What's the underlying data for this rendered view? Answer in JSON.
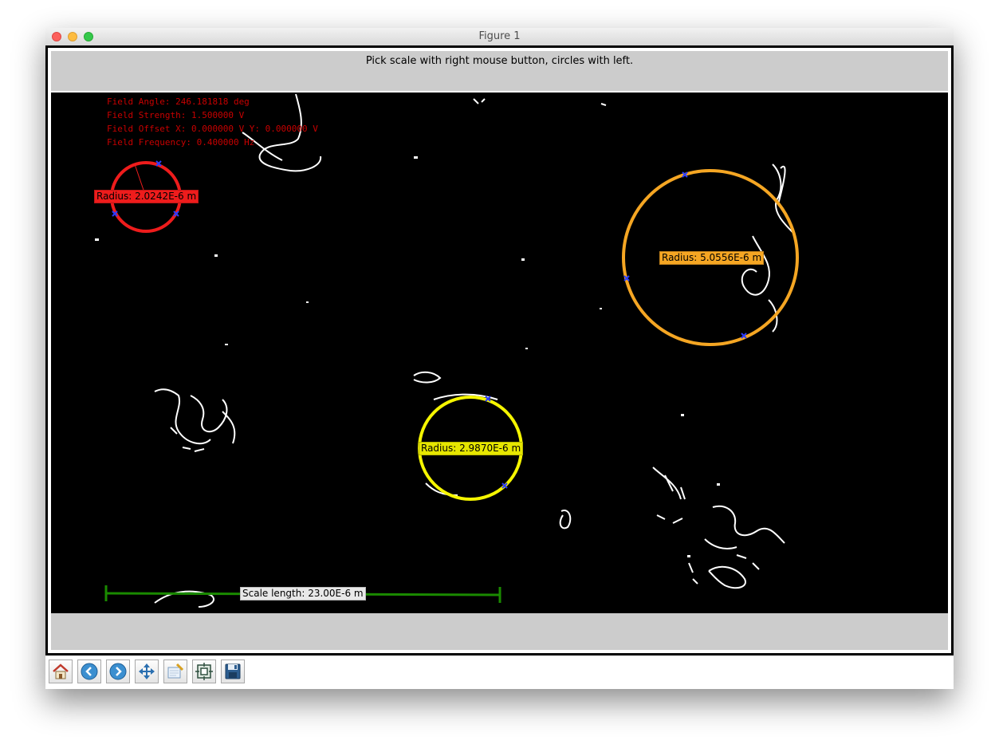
{
  "window": {
    "title": "Figure 1"
  },
  "figure": {
    "instruction": "Pick scale with right mouse button, circles with left.",
    "field_info": [
      "Field Angle: 246.181818 deg",
      "Field Strength: 1.500000 V",
      "Field Offset X: 0.000000 V  Y: 0.000000 V",
      "Field Frequency: 0.400000 Hz"
    ],
    "circles": [
      {
        "label": "Radius: 2.0242E-6 m",
        "color": "#ee1c1c"
      },
      {
        "label": "Radius: 5.0556E-6 m",
        "color": "#f5a623"
      },
      {
        "label": "Radius: 2.9870E-6 m",
        "color": "#f5f500"
      }
    ],
    "scale": {
      "label": "Scale length: 23.00E-6 m",
      "color": "#1a8a00"
    }
  },
  "toolbar": {
    "buttons": [
      {
        "name": "home",
        "icon": "home-icon"
      },
      {
        "name": "back",
        "icon": "back-arrow-icon"
      },
      {
        "name": "forward",
        "icon": "forward-arrow-icon"
      },
      {
        "name": "pan",
        "icon": "pan-arrows-icon"
      },
      {
        "name": "zoom",
        "icon": "zoom-rect-icon"
      },
      {
        "name": "subplots",
        "icon": "configure-subplots-icon"
      },
      {
        "name": "save",
        "icon": "save-floppy-icon"
      }
    ]
  }
}
